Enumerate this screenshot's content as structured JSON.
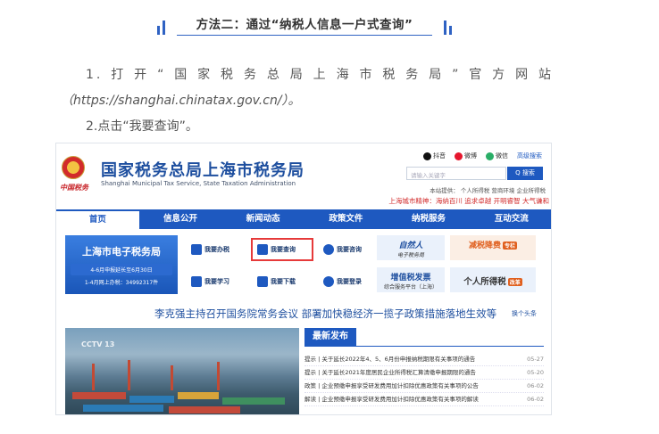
{
  "article": {
    "heading": "方法二：通过“纳税人信息一户式查询”",
    "step1": "1.打开“国家税务总局上海市税务局”官方网站",
    "step1_url": "（https://shanghai.chinatax.gov.cn/）。",
    "step2": "2.点击“我要查询”。"
  },
  "site": {
    "title": "国家税务总局上海市税务局",
    "subtitle": "Shanghai Municipal Tax Service, State Taxation Administration",
    "emblem_caption": "中国税务",
    "tools": {
      "douyin": "抖音",
      "weibo": "微博",
      "wechat": "微信",
      "advanced_search": "高级搜索"
    },
    "search": {
      "placeholder": "请输入关键字",
      "button": "Q 搜索"
    },
    "quick_links": "本站提供： 个人所得税  营商环境  企业所得税",
    "slogan": "上海城市精神：海纳百川 追求卓越 开明睿智 大气谦和",
    "nav": [
      "首页",
      "信息公开",
      "新闻动态",
      "政策文件",
      "纳税服务",
      "互动交流"
    ],
    "etax": {
      "title": "上海市电子税务局",
      "notice": "4-6月申报延长至6月30日",
      "sub": "1-4月网上办税：34992317件"
    },
    "quick_buttons": {
      "handle": "我要办税",
      "query": "我要查询",
      "consult": "我要咨询",
      "learn": "我要学习",
      "download": "我要下载",
      "login": "我要登录"
    },
    "cards": {
      "natural_title": "自然人",
      "natural_sub": "电子税务局",
      "tax_cut": "减税降费",
      "tax_cut_badge": "专栏",
      "vat_title": "增值税发票",
      "vat_sub": "综合服务平台（上海）",
      "iit": "个人所得税",
      "iit_badge": "改革"
    },
    "headline": "李克强主持召开国务院常务会议 部署加快稳经济一揽子政策措施落地生效等",
    "more": "换个头条",
    "photo_logo": "CCTV 13",
    "news_tab": "最新发布",
    "news": [
      {
        "text": "提示 | 关于延长2022年4、5、6月份申报纳税期限有关事项的通告",
        "date": "05-27"
      },
      {
        "text": "提示 | 关于延长2021年度居民企业所得税汇算清缴申报期限的通告",
        "date": "05-20"
      },
      {
        "text": "政策 | 企业预缴申报享受研发费用加计扣除优惠政策有关事项的公告",
        "date": "06-02"
      },
      {
        "text": "解读 | 企业预缴申报享受研发费用加计扣除优惠政策有关事项的解读",
        "date": "06-02"
      }
    ]
  },
  "colors": {
    "brand_blue": "#1e59c0",
    "highlight_red": "#e63a3a",
    "slogan_red": "#d22b2b"
  }
}
